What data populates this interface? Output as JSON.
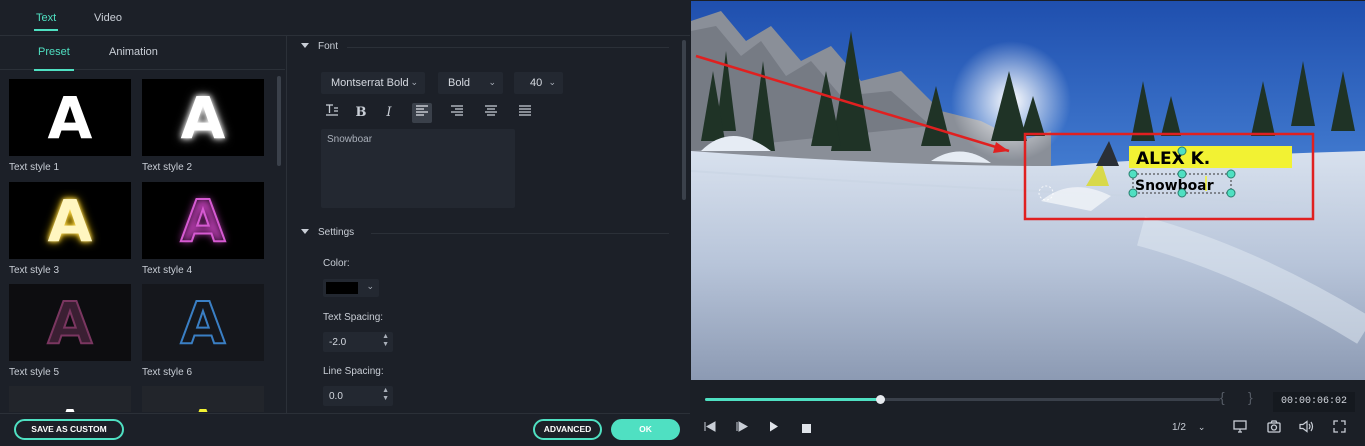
{
  "top_tabs": [
    {
      "label": "Text"
    },
    {
      "label": "Video"
    }
  ],
  "sub_tabs": [
    {
      "label": "Preset"
    },
    {
      "label": "Animation"
    }
  ],
  "presets": [
    {
      "label": "Text style 1",
      "glyph": "A"
    },
    {
      "label": "Text style 2",
      "glyph": "A"
    },
    {
      "label": "Text style 3",
      "glyph": "A"
    },
    {
      "label": "Text style 4",
      "glyph": "A"
    },
    {
      "label": "Text style 5",
      "glyph": "A"
    },
    {
      "label": "Text style 6",
      "glyph": "A"
    },
    {
      "label": "",
      "glyph": "A"
    },
    {
      "label": "",
      "glyph": "A"
    }
  ],
  "font_section": {
    "title": "Font",
    "font_family": "Montserrat Bold",
    "font_weight": "Bold",
    "font_size": "40",
    "text_value": "Snowboar",
    "active_alignment": "align-left"
  },
  "settings_section": {
    "title": "Settings",
    "color_label": "Color:",
    "color_value": "#000000",
    "text_spacing_label": "Text Spacing:",
    "text_spacing_value": "-2.0",
    "line_spacing_label": "Line Spacing:",
    "line_spacing_value": "0.0"
  },
  "buttons": {
    "save_as_custom": "SAVE AS CUSTOM",
    "advanced": "ADVANCED",
    "ok": "OK"
  },
  "preview": {
    "title_text": "ALEX K.",
    "subtitle_text": "Snowboar",
    "progress": 0.34,
    "timecode": "00:00:06:02",
    "quality": "1/2"
  },
  "colors": {
    "accent": "#4fe0c2",
    "title_bg": "#f2f233",
    "annotation": "#e02020"
  }
}
